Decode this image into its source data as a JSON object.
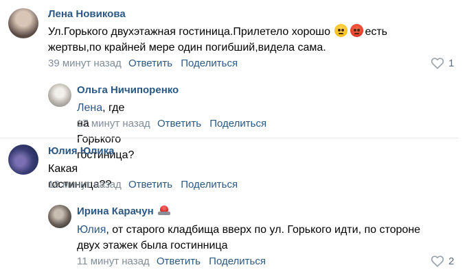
{
  "comments": [
    {
      "author": "Лена Новикова",
      "text_before": "Ул.Горького двухэтажная гостиница.Прилетело хорошо",
      "text_after": "есть жертвы,по крайней мере один погибший,видела сама.",
      "time": "39 минут назад",
      "reply_label": "Ответить",
      "share_label": "Поделиться",
      "likes": "1",
      "avatar_colors": [
        "#5a4a44",
        "#c9b7aa"
      ],
      "emojis": [
        "pleading-face-icon",
        "angry-face-icon"
      ]
    },
    {
      "author": "Ольга Ничипоренко",
      "mention": "Лена",
      "text": ", где на Горького гостиница?",
      "time": "17 минут назад",
      "reply_label": "Ответить",
      "share_label": "Поделиться",
      "avatar_colors": [
        "#dad8d2",
        "#8a8780"
      ]
    },
    {
      "author": "Юлия Юлика",
      "text": "Какая гостиница??",
      "time": "18 минут назад",
      "reply_label": "Ответить",
      "share_label": "Поделиться",
      "avatar_colors": [
        "#1f2a55",
        "#7a6fb0"
      ]
    },
    {
      "author": "Ирина Карачун",
      "mention": "Юлия",
      "text_line1": ", от старого кладбища вверх по ул. Горького идти, по стороне",
      "text_line2": "двух этажек была гостинница",
      "time": "11 минут назад",
      "reply_label": "Ответить",
      "share_label": "Поделиться",
      "likes": "2",
      "avatar_colors": [
        "#2f2a26",
        "#a89d91"
      ],
      "badge": "alarm-light-icon"
    }
  ]
}
